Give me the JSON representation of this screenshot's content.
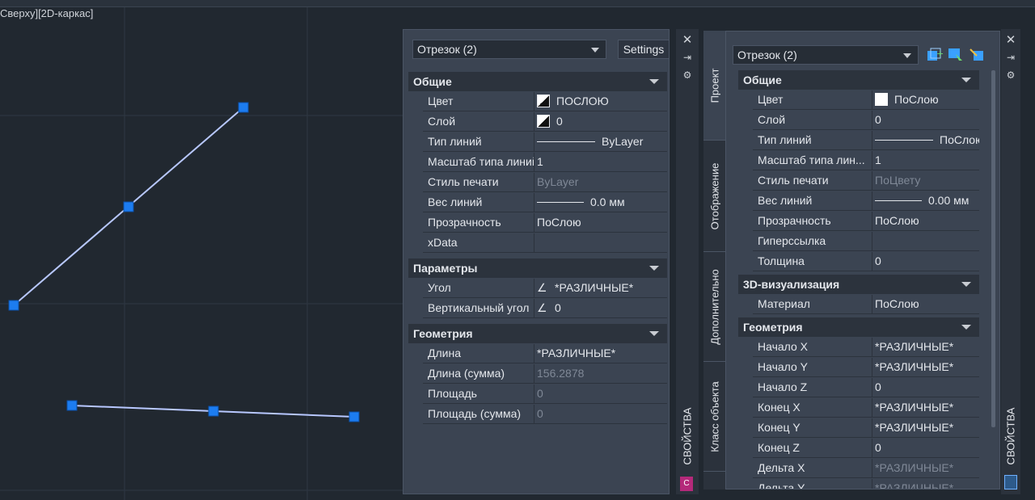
{
  "viewport": {
    "label": "Сверху][2D-каркас]",
    "line_color": "#b8c8ff",
    "grip_color": "#1c7cf0"
  },
  "panel1": {
    "selector": "Отрезок (2)",
    "settings_label": "Settings",
    "sections": [
      {
        "title": "Общие",
        "rows": [
          {
            "label": "Цвет",
            "value": "ПОСЛОЮ",
            "icon": "swatch-half"
          },
          {
            "label": "Слой",
            "value": "0",
            "icon": "swatch-half"
          },
          {
            "label": "Тип линий",
            "value": "ByLayer",
            "icon": "line"
          },
          {
            "label": "Масштаб типа линий",
            "value": "1"
          },
          {
            "label": "Стиль печати",
            "value": "ByLayer",
            "dim": true
          },
          {
            "label": "Вес линий",
            "value": "0.0 мм",
            "icon": "line-short"
          },
          {
            "label": "Прозрачность",
            "value": "ПоСлою"
          },
          {
            "label": "xData",
            "value": ""
          }
        ]
      },
      {
        "title": "Параметры",
        "rows": [
          {
            "label": "Угол",
            "value": "*РАЗЛИЧНЫЕ*",
            "icon": "angle"
          },
          {
            "label": "Вертикальный угол",
            "value": "0",
            "icon": "angle2"
          }
        ]
      },
      {
        "title": "Геометрия",
        "rows": [
          {
            "label": "Длина",
            "value": "*РАЗЛИЧНЫЕ*"
          },
          {
            "label": "Длина (сумма)",
            "value": "156.2878",
            "dim": true
          },
          {
            "label": "Площадь",
            "value": "0",
            "dim": true
          },
          {
            "label": "Площадь (сумма)",
            "value": "0",
            "dim": true
          }
        ]
      }
    ],
    "strip_title": "СВОЙСТВА"
  },
  "panel2": {
    "selector": "Отрезок (2)",
    "tabs": [
      "Проект",
      "Отображение",
      "Дополнительно",
      "Класс объекта"
    ],
    "sections": [
      {
        "title": "Общие",
        "rows": [
          {
            "label": "Цвет",
            "value": "ПоСлою",
            "icon": "swatch-white"
          },
          {
            "label": "Слой",
            "value": "0"
          },
          {
            "label": "Тип линий",
            "value": "ПоСлою",
            "icon": "line"
          },
          {
            "label": "Масштаб типа лин...",
            "value": "1"
          },
          {
            "label": "Стиль печати",
            "value": "ПоЦвету",
            "dim": true
          },
          {
            "label": "Вес линий",
            "value": "0.00 мм",
            "icon": "line-short"
          },
          {
            "label": "Прозрачность",
            "value": "ПоСлою"
          },
          {
            "label": "Гиперссылка",
            "value": ""
          },
          {
            "label": "Толщина",
            "value": "0"
          }
        ]
      },
      {
        "title": "3D-визуализация",
        "rows": [
          {
            "label": "Материал",
            "value": "ПоСлою"
          }
        ]
      },
      {
        "title": "Геометрия",
        "rows": [
          {
            "label": "Начало X",
            "value": "*РАЗЛИЧНЫЕ*"
          },
          {
            "label": "Начало Y",
            "value": "*РАЗЛИЧНЫЕ*"
          },
          {
            "label": "Начало Z",
            "value": "0"
          },
          {
            "label": "Конец X",
            "value": "*РАЗЛИЧНЫЕ*"
          },
          {
            "label": "Конец Y",
            "value": "*РАЗЛИЧНЫЕ*"
          },
          {
            "label": "Конец Z",
            "value": "0"
          },
          {
            "label": "Дельта X",
            "value": "*РАЗЛИЧНЫЕ*",
            "dim": true
          },
          {
            "label": "Дельта Y",
            "value": "*РАЗЛИЧНЫЕ*",
            "dim": true
          }
        ]
      }
    ],
    "strip_title": "СВОЙСТВА"
  }
}
